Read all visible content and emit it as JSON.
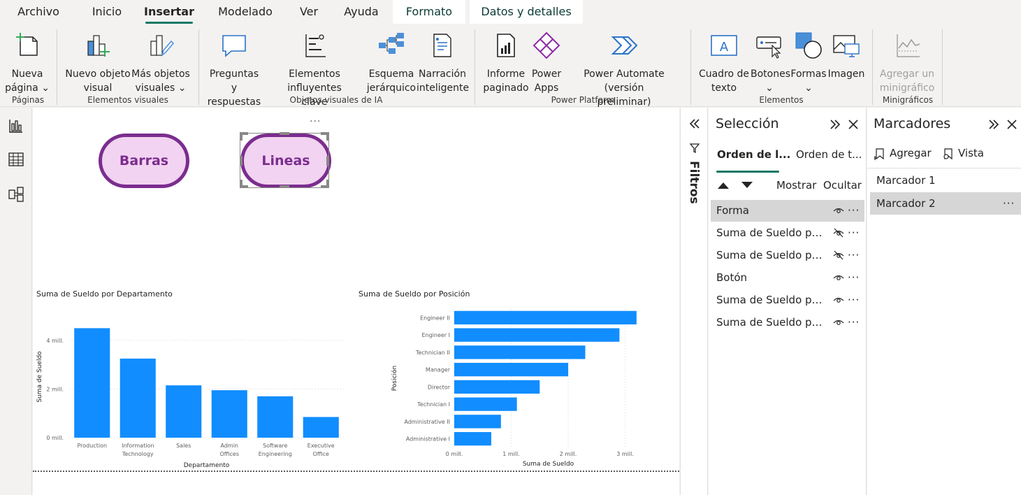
{
  "menu": {
    "tabs": [
      "Archivo",
      "Inicio",
      "Insertar",
      "Modelado",
      "Ver",
      "Ayuda"
    ],
    "active": "Insertar",
    "context_tabs": [
      "Formato",
      "Datos y detalles"
    ]
  },
  "ribbon": {
    "buttons": {
      "nueva_pagina": "Nueva\npágina ⌄",
      "nuevo_objeto_visual": "Nuevo objeto\nvisual",
      "mas_objetos_visuales": "Más objetos\nvisuales ⌄",
      "preguntas_respuestas": "Preguntas y\nrespuestas",
      "elementos_influyentes": "Elementos influyentes\nclave",
      "esquema_jerarquico": "Esquema\njerárquico",
      "narracion_inteligente": "Narración\ninteligente",
      "informe_paginado": "Informe\npaginado",
      "power_apps": "Power\nApps",
      "power_automate": "Power Automate (versión\npreliminar)",
      "cuadro_texto": "Cuadro de\ntexto",
      "botones": "Botones\n⌄",
      "formas": "Formas\n⌄",
      "imagen": "Imagen",
      "agregar_minigrafico": "Agregar un\nminigráfico"
    },
    "groups": {
      "paginas": "Páginas",
      "elementos_visuales": "Elementos visuales",
      "objetos_ia": "Objetos visuales de IA",
      "power_platform": "Power Platform",
      "elementos": "Elementos",
      "minigraficos": "Minigráficos"
    }
  },
  "canvas": {
    "shape_buttons": [
      "Barras",
      "Lineas"
    ],
    "visual_more": "···"
  },
  "chart_data": [
    {
      "type": "bar",
      "title": "Suma de Sueldo por Departamento",
      "xlabel": "Departamento",
      "ylabel": "Suma de Sueldo",
      "categories": [
        "Production",
        "Information Technology",
        "Sales",
        "Admin Offices",
        "Software Engineering",
        "Executive Office"
      ],
      "values": [
        4.5,
        3.25,
        2.15,
        1.95,
        1.7,
        0.85
      ],
      "unit": "mill.",
      "ylim": [
        0,
        5
      ],
      "yticks": [
        "0 mill.",
        "2 mill.",
        "4 mill."
      ],
      "color": "#118dff"
    },
    {
      "type": "bar",
      "orientation": "horizontal",
      "title": "Suma de Sueldo por Posición",
      "xlabel": "Suma de Sueldo",
      "ylabel": "Posición",
      "categories": [
        "Engineer II",
        "Engineer I",
        "Technician II",
        "Manager",
        "Director",
        "Technician I",
        "Administrative II",
        "Administrative I"
      ],
      "values": [
        3.2,
        2.9,
        2.3,
        2.0,
        1.5,
        1.1,
        0.82,
        0.65
      ],
      "unit": "mill.",
      "xlim": [
        0,
        3.3
      ],
      "xticks": [
        "0 mill.",
        "1 mill.",
        "2 mill.",
        "3 mill."
      ],
      "color": "#118dff"
    }
  ],
  "filters": {
    "label": "Filtros"
  },
  "selection": {
    "title": "Selección",
    "tabs": [
      "Orden de l...",
      "Orden de t..."
    ],
    "show": "Mostrar",
    "hide": "Ocultar",
    "layers": [
      {
        "name": "Forma",
        "hidden": false,
        "selected": true
      },
      {
        "name": "Suma de Sueldo por P...",
        "hidden": true,
        "selected": false
      },
      {
        "name": "Suma de Sueldo por ...",
        "hidden": true,
        "selected": false
      },
      {
        "name": "Botón",
        "hidden": false,
        "selected": false
      },
      {
        "name": "Suma de Sueldo por P...",
        "hidden": false,
        "selected": false
      },
      {
        "name": "Suma de Sueldo por ...",
        "hidden": false,
        "selected": false
      }
    ],
    "more": "···"
  },
  "bookmarks": {
    "title": "Marcadores",
    "add": "Agregar",
    "view": "Vista",
    "items": [
      {
        "name": "Marcador 1",
        "selected": false
      },
      {
        "name": "Marcador 2",
        "selected": true
      }
    ],
    "more": "···"
  }
}
